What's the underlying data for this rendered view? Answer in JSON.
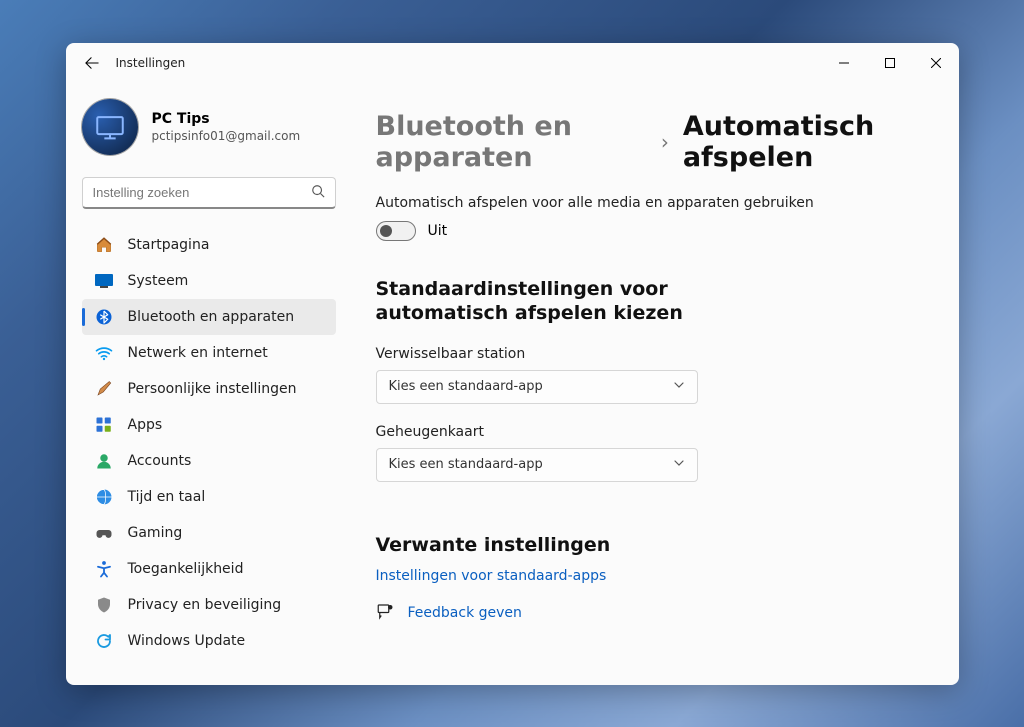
{
  "window": {
    "title": "Instellingen"
  },
  "profile": {
    "name": "PC Tips",
    "email": "pctipsinfo01@gmail.com"
  },
  "search": {
    "placeholder": "Instelling zoeken"
  },
  "nav": {
    "items": [
      {
        "id": "home",
        "label": "Startpagina"
      },
      {
        "id": "system",
        "label": "Systeem"
      },
      {
        "id": "bluetooth",
        "label": "Bluetooth en apparaten"
      },
      {
        "id": "network",
        "label": "Netwerk en internet"
      },
      {
        "id": "personal",
        "label": "Persoonlijke instellingen"
      },
      {
        "id": "apps",
        "label": "Apps"
      },
      {
        "id": "accounts",
        "label": "Accounts"
      },
      {
        "id": "time",
        "label": "Tijd en taal"
      },
      {
        "id": "gaming",
        "label": "Gaming"
      },
      {
        "id": "access",
        "label": "Toegankelijkheid"
      },
      {
        "id": "privacy",
        "label": "Privacy en beveiliging"
      },
      {
        "id": "update",
        "label": "Windows Update"
      }
    ],
    "activeIndex": 2
  },
  "breadcrumb": {
    "parent": "Bluetooth en apparaten",
    "current": "Automatisch afspelen"
  },
  "autoplay": {
    "description": "Automatisch afspelen voor alle media en apparaten gebruiken",
    "toggle": {
      "on": false,
      "label": "Uit"
    }
  },
  "defaults": {
    "heading": "Standaardinstellingen voor automatisch afspelen kiezen",
    "fields": [
      {
        "label": "Verwisselbaar station",
        "value": "Kies een standaard-app"
      },
      {
        "label": "Geheugenkaart",
        "value": "Kies een standaard-app"
      }
    ]
  },
  "related": {
    "heading": "Verwante instellingen",
    "link": "Instellingen voor standaard-apps",
    "feedback": "Feedback geven"
  }
}
